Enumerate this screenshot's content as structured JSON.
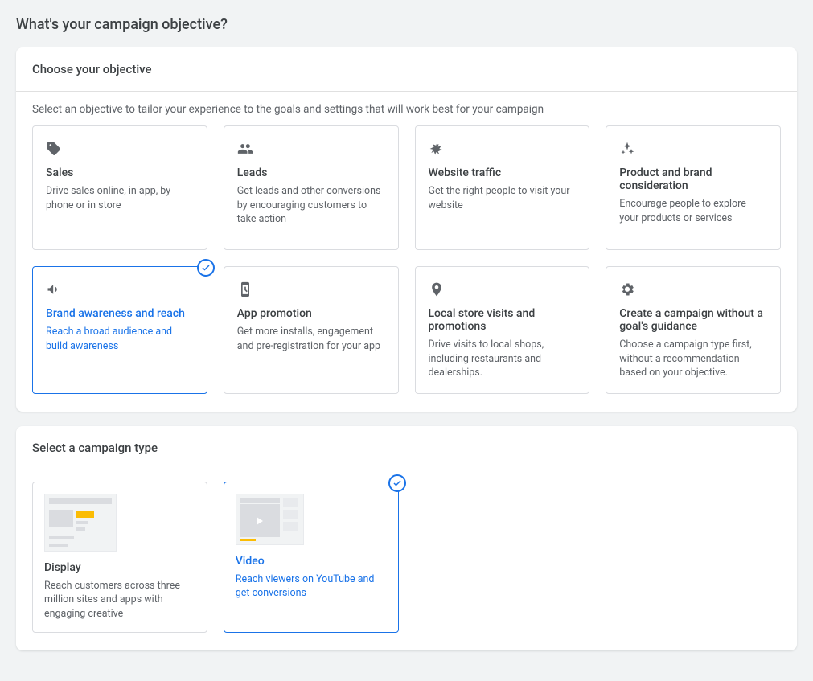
{
  "page_title": "What's your campaign objective?",
  "objective_panel": {
    "header": "Choose your objective",
    "subtext": "Select an objective to tailor your experience to the goals and settings that will work best for your campaign",
    "cards": [
      {
        "icon": "tag",
        "title": "Sales",
        "desc": "Drive sales online, in app, by phone or in store",
        "selected": false
      },
      {
        "icon": "group",
        "title": "Leads",
        "desc": "Get leads and other conversions by encouraging customers to take action",
        "selected": false
      },
      {
        "icon": "click",
        "title": "Website traffic",
        "desc": "Get the right people to visit your website",
        "selected": false
      },
      {
        "icon": "sparkle",
        "title": "Product and brand consideration",
        "desc": "Encourage people to explore your products or services",
        "selected": false
      },
      {
        "icon": "megaphone",
        "title": "Brand awareness and reach",
        "desc": "Reach a broad audience and build awareness",
        "selected": true
      },
      {
        "icon": "phone",
        "title": "App promotion",
        "desc": "Get more installs, engagement and pre-registration for your app",
        "selected": false
      },
      {
        "icon": "pin",
        "title": "Local store visits and promotions",
        "desc": "Drive visits to local shops, including restaurants and dealerships.",
        "selected": false
      },
      {
        "icon": "gear",
        "title": "Create a campaign without a goal's guidance",
        "desc": "Choose a campaign type first, without a recommendation based on your objective.",
        "selected": false
      }
    ]
  },
  "type_panel": {
    "header": "Select a campaign type",
    "cards": [
      {
        "thumb": "display",
        "title": "Display",
        "desc": "Reach customers across three million sites and apps with engaging creative",
        "selected": false
      },
      {
        "thumb": "video",
        "title": "Video",
        "desc": "Reach viewers on YouTube and get conversions",
        "selected": true
      }
    ]
  }
}
